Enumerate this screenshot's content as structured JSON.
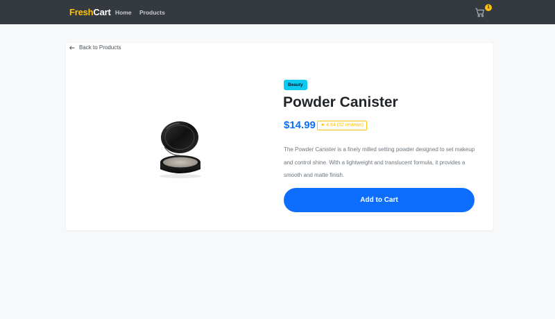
{
  "navbar": {
    "brand_fresh": "Fresh",
    "brand_cart": "Cart",
    "links": {
      "home": "Home",
      "products": "Products"
    },
    "cart_count": "1"
  },
  "page": {
    "back_link": "Back to Products"
  },
  "product": {
    "category": "Beauty",
    "title": "Powder Canister",
    "price": "$14.99",
    "rating": "★ 4.64 (52 reviews)",
    "description": "The Powder Canister is a finely milled setting powder designed to set makeup and control shine. With a lightweight and translucent formula, it provides a smooth and matte finish.",
    "add_to_cart_label": "Add to Cart"
  },
  "colors": {
    "navbar_bg": "#343a40",
    "brand_accent": "#ffc107",
    "primary": "#0d6efd",
    "badge_bg": "#0dcaf0",
    "rating": "#ffc107"
  },
  "icons": {
    "cart": "cart-icon",
    "back": "arrow-left-icon"
  }
}
